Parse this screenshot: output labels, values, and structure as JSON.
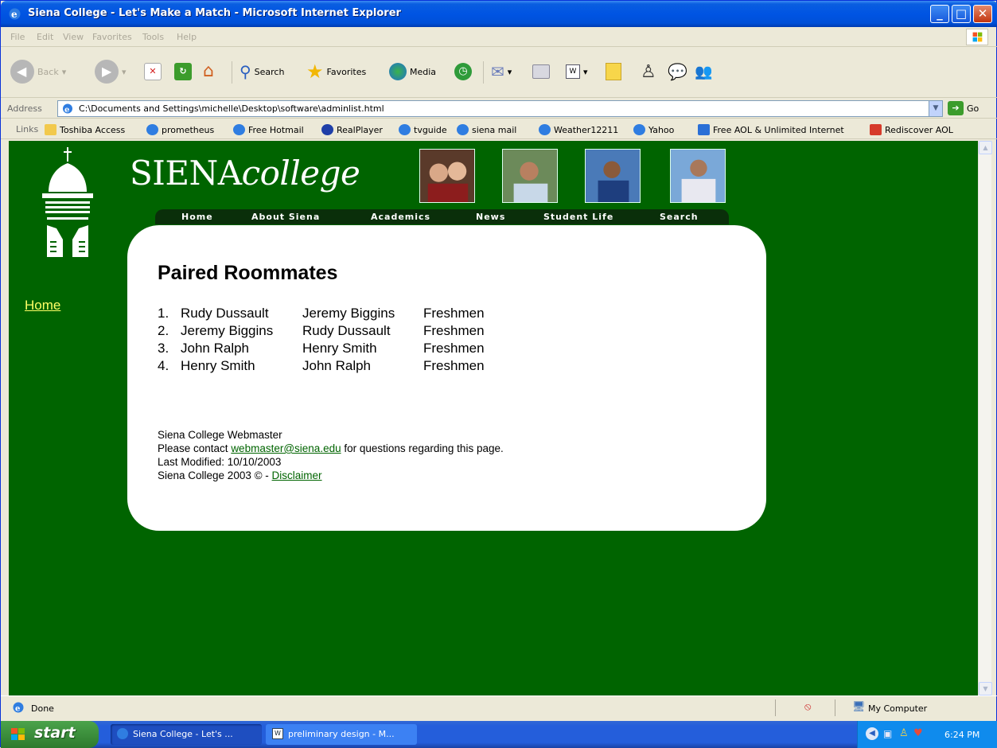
{
  "window": {
    "title": "Siena College - Let's Make a Match - Microsoft Internet Explorer",
    "controls": [
      "minimize",
      "maximize",
      "close"
    ]
  },
  "menu": [
    "File",
    "Edit",
    "View",
    "Favorites",
    "Tools",
    "Help"
  ],
  "toolbar": {
    "back": "Back",
    "search": "Search",
    "favorites": "Favorites",
    "media": "Media"
  },
  "address": {
    "label": "Address",
    "url": "C:\\Documents and Settings\\michelle\\Desktop\\software\\adminlist.html",
    "go": "Go"
  },
  "links": {
    "label": "Links",
    "items": [
      "Toshiba Access",
      "prometheus",
      "Free Hotmail",
      "RealPlayer",
      "tvguide",
      "siena mail",
      "Weather12211",
      "Yahoo",
      "Free AOL & Unlimited Internet",
      "Rediscover AOL"
    ]
  },
  "page": {
    "brand_main": "SIENA",
    "brand_sub": "college",
    "nav": [
      "Home",
      "About Siena",
      "Academics",
      "News",
      "Student Life",
      "Search"
    ],
    "side_home": "Home",
    "title": "Paired Roommates",
    "roommates": [
      {
        "n": "1.",
        "a": "Rudy Dussault",
        "b": "Jeremy Biggins",
        "c": "Freshmen"
      },
      {
        "n": "2.",
        "a": "Jeremy Biggins",
        "b": "Rudy Dussault",
        "c": "Freshmen"
      },
      {
        "n": "3.",
        "a": "John Ralph",
        "b": "Henry Smith",
        "c": "Freshmen"
      },
      {
        "n": "4.",
        "a": "Henry Smith",
        "b": "John Ralph",
        "c": "Freshmen"
      }
    ],
    "footer": {
      "line1": "Siena College Webmaster",
      "contact_pre": "Please contact ",
      "email": "webmaster@siena.edu",
      "contact_post": " for questions regarding this page.",
      "modified": "Last Modified: 10/10/2003",
      "copyright_pre": "Siena College 2003 © - ",
      "disclaimer": "Disclaimer"
    }
  },
  "status": {
    "text": "Done",
    "zone": "My Computer"
  },
  "taskbar": {
    "start": "start",
    "tasks": [
      "Siena College - Let's ...",
      "preliminary design - M..."
    ],
    "clock": "6:24 PM"
  }
}
